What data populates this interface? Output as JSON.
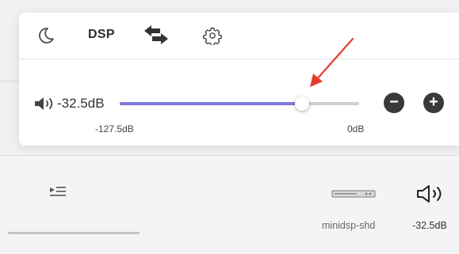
{
  "toolbar": {
    "dsp_label": "DSP",
    "icons": [
      "moon-icon",
      "swap-arrows-icon",
      "gear-icon"
    ]
  },
  "volume": {
    "value_label": "-32.5dB",
    "min_label": "-127.5dB",
    "max_label": "0dB",
    "level_fraction": 0.76,
    "minus_label": "−",
    "plus_label": "+"
  },
  "player": {
    "device_name": "minidsp-shd",
    "volume_label": "-32.5dB"
  },
  "colors": {
    "slider_fill": "#7b78df",
    "annotation_arrow": "#e53b2c",
    "button_dark": "#3a3a3a"
  }
}
